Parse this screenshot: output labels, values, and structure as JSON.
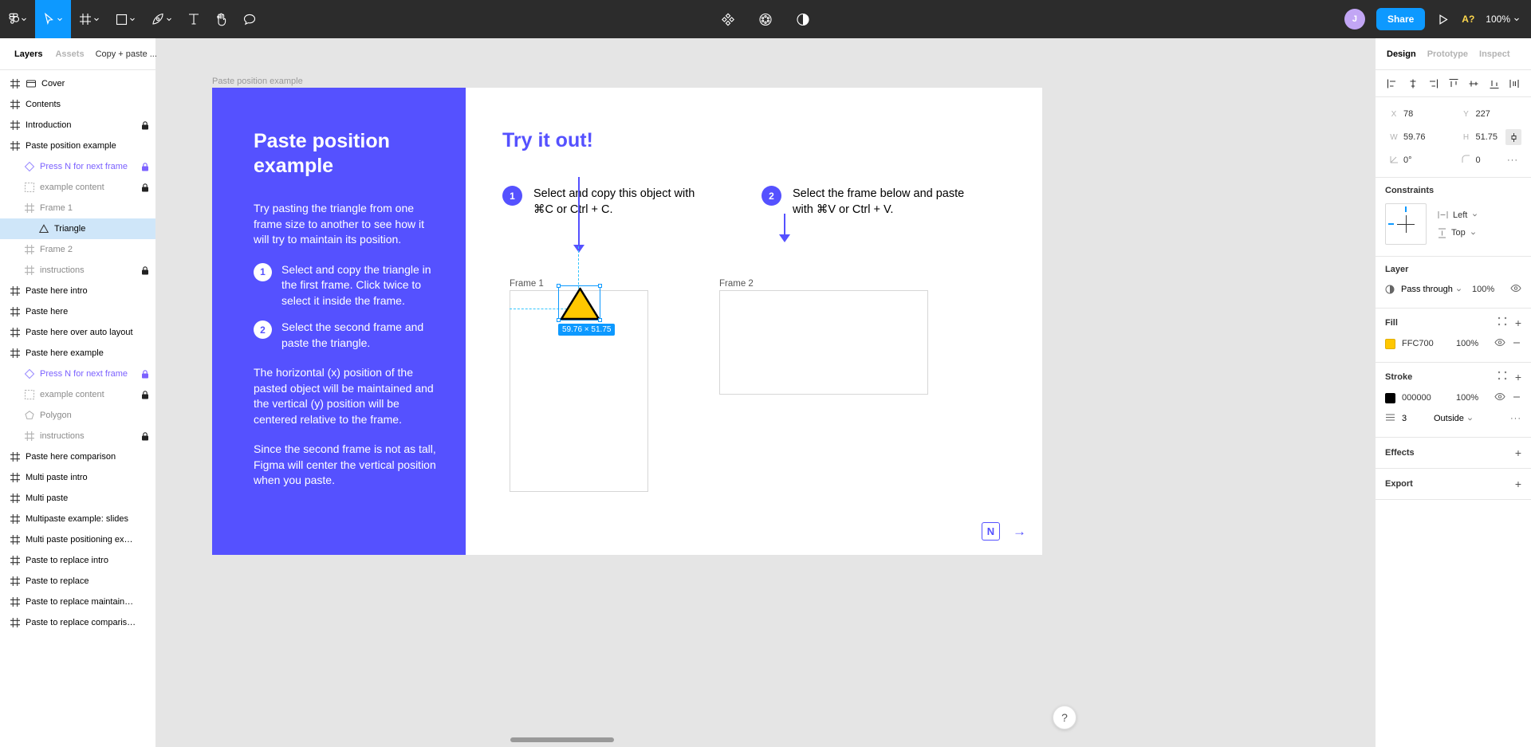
{
  "toolbar": {
    "left_tools": [
      {
        "name": "figma-menu",
        "icon": "figma-logo",
        "caret": true
      },
      {
        "name": "move-tool",
        "icon": "cursor",
        "caret": true,
        "active": true
      },
      {
        "name": "frame-tool",
        "icon": "frame",
        "caret": true
      },
      {
        "name": "shape-tool",
        "icon": "square",
        "caret": true
      },
      {
        "name": "pen-tool",
        "icon": "pen",
        "caret": true
      },
      {
        "name": "text-tool",
        "icon": "text-T",
        "caret": false
      },
      {
        "name": "hand-tool",
        "icon": "hand",
        "caret": false
      },
      {
        "name": "comment-tool",
        "icon": "comment-bubble",
        "caret": false
      }
    ],
    "center_tools": [
      {
        "name": "components-tool",
        "icon": "components"
      },
      {
        "name": "plugins-tool",
        "icon": "plugins"
      },
      {
        "name": "dev-mode-tool",
        "icon": "contrast-circle"
      }
    ],
    "avatar_initial": "J",
    "share_label": "Share",
    "present_icon": "play-triangle",
    "anon_badge": "A?",
    "zoom_level": "100%"
  },
  "left_panel": {
    "tabs": [
      {
        "label": "Layers",
        "active": true
      },
      {
        "label": "Assets",
        "active": false
      }
    ],
    "page_name": "Copy + paste ...",
    "layers": [
      {
        "name": "Cover",
        "icon": "frame-hash",
        "icon2": "cover",
        "depth": 0,
        "locked": false,
        "dim": false,
        "selected": false,
        "purple": false
      },
      {
        "name": "Contents",
        "icon": "frame-hash",
        "depth": 0,
        "locked": false,
        "dim": false,
        "selected": false,
        "purple": false
      },
      {
        "name": "Introduction",
        "icon": "frame-hash",
        "depth": 0,
        "locked": true,
        "dim": false,
        "selected": false,
        "purple": false
      },
      {
        "name": "Paste position example",
        "icon": "frame-hash",
        "depth": 0,
        "locked": false,
        "dim": false,
        "selected": false,
        "purple": false
      },
      {
        "name": "Press N for next frame",
        "icon": "component-diamond",
        "depth": 1,
        "locked": true,
        "dim": false,
        "selected": false,
        "purple": true
      },
      {
        "name": "example content",
        "icon": "group-dashed",
        "depth": 1,
        "locked": true,
        "dim": true,
        "selected": false,
        "purple": false
      },
      {
        "name": "Frame 1",
        "icon": "frame-hash",
        "depth": 1,
        "locked": false,
        "dim": true,
        "selected": false,
        "purple": false
      },
      {
        "name": "Triangle",
        "icon": "triangle-shape",
        "depth": 2,
        "locked": false,
        "dim": false,
        "selected": true,
        "purple": false
      },
      {
        "name": "Frame 2",
        "icon": "frame-hash",
        "depth": 1,
        "locked": false,
        "dim": true,
        "selected": false,
        "purple": false
      },
      {
        "name": "instructions",
        "icon": "frame-hash",
        "depth": 1,
        "locked": true,
        "dim": true,
        "selected": false,
        "purple": false
      },
      {
        "name": "Paste here intro",
        "icon": "frame-hash",
        "depth": 0,
        "locked": false,
        "dim": false,
        "selected": false,
        "purple": false
      },
      {
        "name": "Paste here",
        "icon": "frame-hash",
        "depth": 0,
        "locked": false,
        "dim": false,
        "selected": false,
        "purple": false
      },
      {
        "name": "Paste here over auto layout",
        "icon": "frame-hash",
        "depth": 0,
        "locked": false,
        "dim": false,
        "selected": false,
        "purple": false
      },
      {
        "name": "Paste here example",
        "icon": "frame-hash",
        "depth": 0,
        "locked": false,
        "dim": false,
        "selected": false,
        "purple": false
      },
      {
        "name": "Press N for next frame",
        "icon": "component-diamond",
        "depth": 1,
        "locked": true,
        "dim": false,
        "selected": false,
        "purple": true
      },
      {
        "name": "example content",
        "icon": "group-dashed",
        "depth": 1,
        "locked": true,
        "dim": true,
        "selected": false,
        "purple": false
      },
      {
        "name": "Polygon",
        "icon": "polygon-shape",
        "depth": 1,
        "locked": false,
        "dim": true,
        "selected": false,
        "purple": false
      },
      {
        "name": "instructions",
        "icon": "frame-hash",
        "depth": 1,
        "locked": true,
        "dim": true,
        "selected": false,
        "purple": false
      },
      {
        "name": "Paste here comparison",
        "icon": "frame-hash",
        "depth": 0,
        "locked": false,
        "dim": false,
        "selected": false,
        "purple": false
      },
      {
        "name": "Multi paste intro",
        "icon": "frame-hash",
        "depth": 0,
        "locked": false,
        "dim": false,
        "selected": false,
        "purple": false
      },
      {
        "name": "Multi paste",
        "icon": "frame-hash",
        "depth": 0,
        "locked": false,
        "dim": false,
        "selected": false,
        "purple": false
      },
      {
        "name": "Multipaste example: slides",
        "icon": "frame-hash",
        "depth": 0,
        "locked": false,
        "dim": false,
        "selected": false,
        "purple": false
      },
      {
        "name": "Multi paste positioning example",
        "icon": "frame-hash",
        "depth": 0,
        "locked": false,
        "dim": false,
        "selected": false,
        "purple": false
      },
      {
        "name": "Paste to replace intro",
        "icon": "frame-hash",
        "depth": 0,
        "locked": false,
        "dim": false,
        "selected": false,
        "purple": false
      },
      {
        "name": "Paste to replace",
        "icon": "frame-hash",
        "depth": 0,
        "locked": false,
        "dim": false,
        "selected": false,
        "purple": false
      },
      {
        "name": "Paste to replace maintains object ...",
        "icon": "frame-hash",
        "depth": 0,
        "locked": false,
        "dim": false,
        "selected": false,
        "purple": false
      },
      {
        "name": "Paste to replace comparison",
        "icon": "frame-hash",
        "depth": 0,
        "locked": false,
        "dim": false,
        "selected": false,
        "purple": false
      }
    ]
  },
  "canvas": {
    "frame_label": "Paste position example",
    "slide": {
      "left": {
        "title": "Paste position example",
        "intro": "Try pasting the triangle from one frame size to another to see how it will try to maintain its position.",
        "steps": [
          {
            "num": "1",
            "text": "Select and copy the triangle in the first frame. Click twice to select it inside the frame."
          },
          {
            "num": "2",
            "text": "Select the second frame and paste the triangle."
          }
        ],
        "note1": "The horizontal (x) position of the pasted object will be maintained and the vertical (y) position will be centered relative to the frame.",
        "note2": "Since the second frame is not as tall, Figma will center the vertical position when you paste."
      },
      "right": {
        "heading": "Try it out!",
        "steps": [
          {
            "num": "1",
            "text": "Select and copy this object with ⌘C or Ctrl + C."
          },
          {
            "num": "2",
            "text": "Select the frame below and paste with ⌘V or Ctrl + V."
          }
        ],
        "frame1_label": "Frame 1",
        "frame2_label": "Frame 2",
        "selection_size_badge": "59.76 × 51.75",
        "next_key": "N",
        "next_arrow": "→"
      }
    }
  },
  "right_panel": {
    "tabs": [
      {
        "label": "Design",
        "active": true
      },
      {
        "label": "Prototype",
        "active": false
      },
      {
        "label": "Inspect",
        "active": false
      }
    ],
    "align_buttons": [
      "align-left",
      "align-horizontal-center",
      "align-right",
      "align-top",
      "align-vertical-center",
      "align-bottom",
      "distribute"
    ],
    "position": {
      "x_label": "X",
      "x_value": "78",
      "y_label": "Y",
      "y_value": "227",
      "w_label": "W",
      "w_value": "59.76",
      "h_label": "H",
      "h_value": "51.75",
      "rotation_label": "rotation",
      "rotation_value": "0°",
      "corner_label": "corner-radius",
      "corner_value": "0",
      "proportion_lock": "constrain-proportions",
      "more": "···"
    },
    "constraints": {
      "title": "Constraints",
      "horizontal": "Left",
      "vertical": "Top"
    },
    "layer": {
      "title": "Layer",
      "blend_mode": "Pass through",
      "opacity": "100%"
    },
    "fill": {
      "title": "Fill",
      "color_hex": "FFC700",
      "color_swatch": "#FFC700",
      "opacity": "100%"
    },
    "stroke": {
      "title": "Stroke",
      "color_hex": "000000",
      "color_swatch": "#000000",
      "opacity": "100%",
      "weight": "3",
      "align": "Outside"
    },
    "effects": {
      "title": "Effects"
    },
    "export": {
      "title": "Export"
    }
  },
  "colors": {
    "brand_purple": "#5551ff",
    "figma_blue": "#0d99ff",
    "toolbar_bg": "#2c2c2c",
    "canvas_bg": "#e5e5e5",
    "yellow_fill": "#FFC700",
    "guide_cyan": "#33c5ff"
  },
  "help": {
    "label": "?"
  }
}
